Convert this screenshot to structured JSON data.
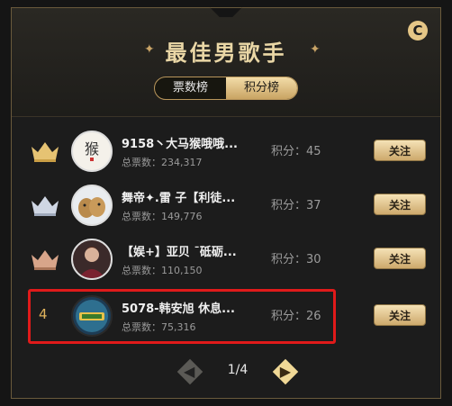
{
  "header": {
    "title": "最佳男歌手",
    "spark": "✦",
    "refresh_glyph": "C"
  },
  "tabs": [
    {
      "label": "票数榜",
      "active": true
    },
    {
      "label": "积分榜",
      "active": false
    }
  ],
  "rows": [
    {
      "rank": "1",
      "crown": "gold",
      "name": "9158丶大马猴哦哦...",
      "votes": "总票数：234,317",
      "score": "积分：45",
      "follow": "关注"
    },
    {
      "rank": "2",
      "crown": "silver",
      "name": "舞帝✦.雷 子【利徒...",
      "votes": "总票数：149,776",
      "score": "积分：37",
      "follow": "关注"
    },
    {
      "rank": "3",
      "crown": "bronze",
      "name": "【娱+】亚贝 ˉ砥砺...",
      "votes": "总票数：110,150",
      "score": "积分：30",
      "follow": "关注"
    },
    {
      "rank": "4",
      "crown": "none",
      "name": "5078-韩安旭 休息...",
      "votes": "总票数：75,316",
      "score": "积分：26",
      "follow": "关注"
    }
  ],
  "pager": {
    "label": "1/4",
    "prev": "◀",
    "next": "▶"
  },
  "colors": {
    "gold": "#e6c373",
    "silver": "#cfd6e3",
    "bronze": "#d8a58a",
    "accent": "#e0b35c",
    "highlight": "#e01a1a"
  },
  "icons": {
    "crown": "crown-icon",
    "refresh": "refresh-icon"
  }
}
